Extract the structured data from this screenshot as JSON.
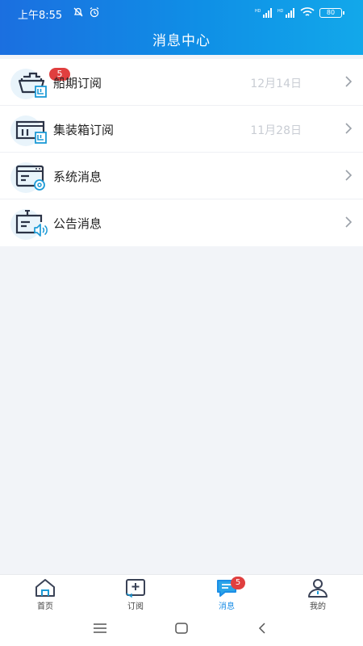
{
  "status_bar": {
    "time": "上午8:55",
    "net1": "HD",
    "net2": "HD",
    "battery": "80"
  },
  "header": {
    "title": "消息中心"
  },
  "messages": [
    {
      "label": "船期订阅",
      "date": "12月14日",
      "badge": "5",
      "icon": "ship-icon"
    },
    {
      "label": "集装箱订阅",
      "date": "11月28日",
      "badge": "",
      "icon": "container-icon"
    },
    {
      "label": "系统消息",
      "date": "",
      "badge": "",
      "icon": "system-settings-icon"
    },
    {
      "label": "公告消息",
      "date": "",
      "badge": "",
      "icon": "announcement-icon"
    }
  ],
  "tabbar": {
    "items": [
      {
        "label": "首页",
        "icon": "home-icon",
        "active": false
      },
      {
        "label": "订阅",
        "icon": "subscribe-icon",
        "active": false
      },
      {
        "label": "消息",
        "icon": "message-icon",
        "active": true,
        "badge": "5"
      },
      {
        "label": "我的",
        "icon": "profile-icon",
        "active": false
      }
    ]
  },
  "colors": {
    "header_start": "#1b6fe0",
    "header_end": "#12a8ea",
    "badge": "#e03f3f",
    "active_tab": "#1c8ee6",
    "icon_dark": "#2b3346",
    "icon_accent": "#1c9ad6"
  }
}
